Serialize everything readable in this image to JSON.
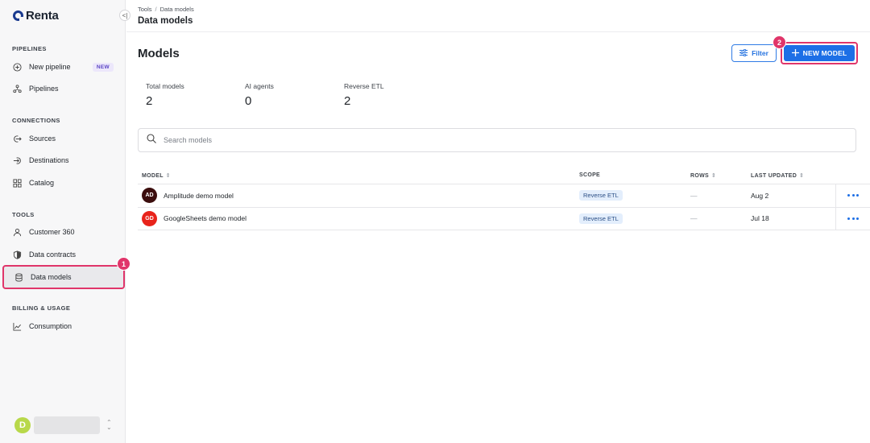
{
  "brand": {
    "name": "Renta"
  },
  "sidebar": {
    "sections": [
      {
        "title": "PIPELINES"
      },
      {
        "title": "CONNECTIONS"
      },
      {
        "title": "TOOLS"
      },
      {
        "title": "BILLING & USAGE"
      }
    ],
    "items": [
      {
        "label": "New pipeline",
        "icon": "plus-circle-icon",
        "badge": "NEW"
      },
      {
        "label": "Pipelines",
        "icon": "pipelines-icon"
      },
      {
        "label": "Sources",
        "icon": "source-icon"
      },
      {
        "label": "Destinations",
        "icon": "destination-icon"
      },
      {
        "label": "Catalog",
        "icon": "catalog-icon"
      },
      {
        "label": "Customer 360",
        "icon": "user-icon"
      },
      {
        "label": "Data contracts",
        "icon": "shield-icon"
      },
      {
        "label": "Data models",
        "icon": "database-icon",
        "active": true
      },
      {
        "label": "Consumption",
        "icon": "chart-line-icon"
      }
    ],
    "user": {
      "initial": "D"
    },
    "markers": {
      "step1": "1"
    }
  },
  "header": {
    "breadcrumb": [
      "Tools",
      "Data models"
    ],
    "breadcrumb_sep": "/",
    "title": "Data models"
  },
  "main": {
    "title": "Models",
    "filter_label": "Filter",
    "new_label": "NEW MODEL",
    "step2": "2",
    "stats": [
      {
        "label": "Total models",
        "value": "2"
      },
      {
        "label": "AI agents",
        "value": "0"
      },
      {
        "label": "Reverse ETL",
        "value": "2"
      }
    ],
    "search_placeholder": "Search models",
    "table": {
      "columns": [
        "MODEL",
        "SCOPE",
        "ROWS",
        "LAST UPDATED"
      ],
      "rows": [
        {
          "initials": "AD",
          "avatar_color": "#3b0d0d",
          "name": "Amplitude demo model",
          "scope": "Reverse ETL",
          "rows": "—",
          "updated": "Aug 2"
        },
        {
          "initials": "GD",
          "avatar_color": "#e8231b",
          "name": "GoogleSheets demo model",
          "scope": "Reverse ETL",
          "rows": "—",
          "updated": "Jul 18"
        }
      ]
    }
  },
  "colors": {
    "accent": "#1d6fe6",
    "highlight": "#e0356a"
  }
}
